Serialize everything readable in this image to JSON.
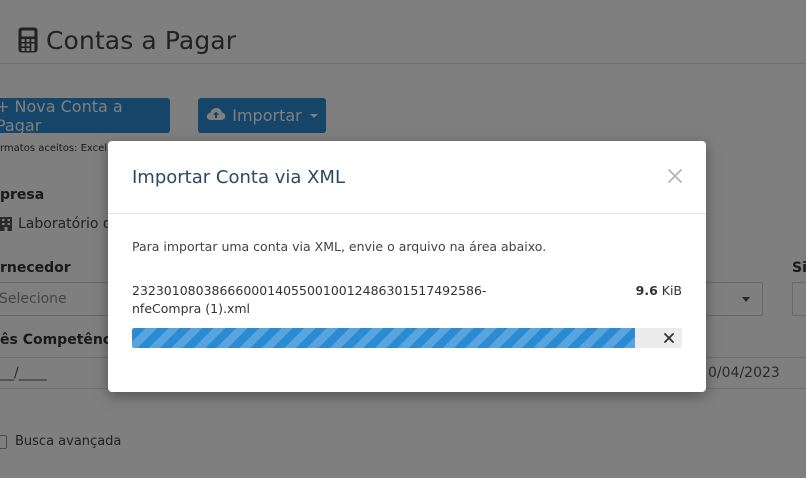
{
  "page": {
    "title": "Contas a Pagar",
    "buttons": {
      "new": "+ Nova Conta a Pagar",
      "import": "Importar"
    },
    "formats_note": "rmatos aceitos: Excel,",
    "labels": {
      "empresa": "presa",
      "fornecedor": "rnecedor",
      "competencia": "ês Competência",
      "situacao": "Si"
    },
    "company_value": "Laboratório d",
    "fornecedor_placeholder": "Selecione",
    "competencia_value": "__/____",
    "date_value": "0/04/2023",
    "advanced_search": "Busca avançada"
  },
  "modal": {
    "title": "Importar Conta via XML",
    "intro": "Para importar uma conta via XML, envie o arquivo na área abaixo.",
    "file": {
      "name": "23230108038666000140550010012486301517492586-nfeCompra (1).xml",
      "size_value": "9.6",
      "size_unit": " KiB",
      "progress": 0.915
    }
  },
  "colors": {
    "primary": "#2a8bd3",
    "overlay": "rgba(0,0,0,0.5)"
  },
  "icons": {
    "title": "calculator-icon",
    "import": "cloud-upload-icon",
    "company": "building-icon",
    "close": "close-icon",
    "cancel": "cancel-upload-icon"
  }
}
